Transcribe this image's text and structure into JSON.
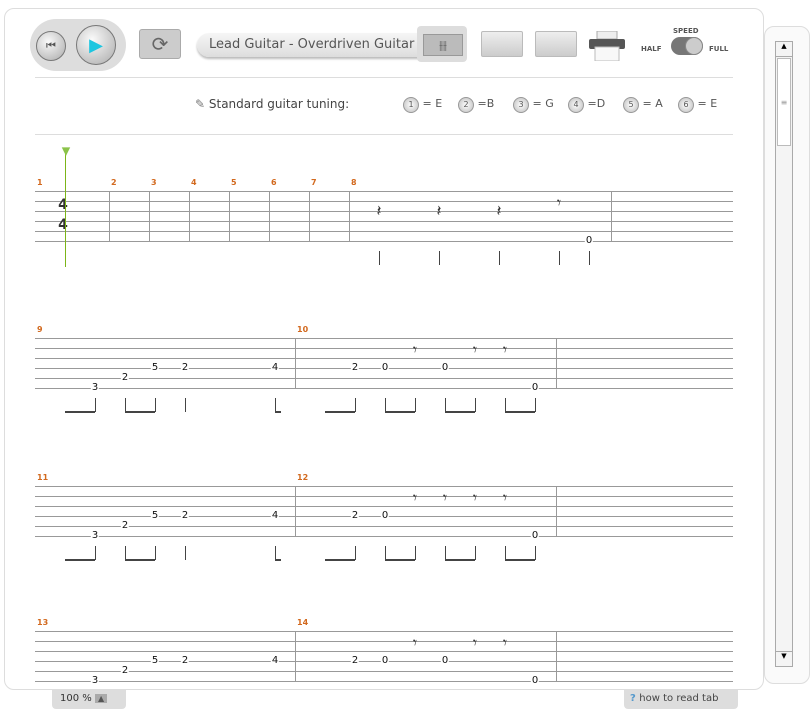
{
  "toolbar": {
    "track_name": "Lead Guitar - Overdriven Guitar",
    "speed_label": "SPEED",
    "speed_half": "HALF",
    "speed_full": "FULL",
    "speed_value": "full"
  },
  "tuning": {
    "label": "Standard guitar tuning:",
    "strings": [
      {
        "num": "1",
        "note": "= E"
      },
      {
        "num": "2",
        "note": "=B"
      },
      {
        "num": "3",
        "note": "= G"
      },
      {
        "num": "4",
        "note": "=D"
      },
      {
        "num": "5",
        "note": "= A"
      },
      {
        "num": "6",
        "note": "= E"
      }
    ]
  },
  "score": {
    "time_signature": [
      "4",
      "4"
    ],
    "playhead_measure": 1,
    "systems": [
      {
        "measures": [
          {
            "num": "1",
            "notes": []
          },
          {
            "num": "2",
            "notes": []
          },
          {
            "num": "3",
            "notes": []
          },
          {
            "num": "4",
            "notes": []
          },
          {
            "num": "5",
            "notes": []
          },
          {
            "num": "6",
            "notes": []
          },
          {
            "num": "7",
            "notes": []
          },
          {
            "num": "8",
            "notes": [
              {
                "rest": "quarter",
                "beat": 0
              },
              {
                "rest": "quarter",
                "beat": 2
              },
              {
                "rest": "quarter",
                "beat": 4
              },
              {
                "rest": "eighth",
                "beat": 6
              },
              {
                "string": 6,
                "fret": "0",
                "beat": 7
              }
            ]
          }
        ]
      },
      {
        "measures": [
          {
            "num": "9",
            "notes": [
              {
                "string": 6,
                "fret": "3",
                "beat": 2
              },
              {
                "string": 5,
                "fret": "2",
                "beat": 3
              },
              {
                "string": 4,
                "fret": "5",
                "beat": 4
              },
              {
                "string": 4,
                "fret": "2",
                "beat": 5
              },
              {
                "string": 4,
                "fret": "4",
                "beat": 8
              }
            ]
          },
          {
            "num": "10",
            "notes": [
              {
                "string": 4,
                "fret": "2",
                "beat": 2
              },
              {
                "string": 4,
                "fret": "0",
                "beat": 3
              },
              {
                "rest": "eighth",
                "beat": 4
              },
              {
                "string": 4,
                "fret": "0",
                "beat": 5
              },
              {
                "rest": "eighth",
                "beat": 6
              },
              {
                "rest": "eighth",
                "beat": 7
              },
              {
                "string": 6,
                "fret": "0",
                "beat": 8
              }
            ]
          }
        ]
      },
      {
        "measures": [
          {
            "num": "11",
            "notes": [
              {
                "string": 6,
                "fret": "3",
                "beat": 2
              },
              {
                "string": 5,
                "fret": "2",
                "beat": 3
              },
              {
                "string": 4,
                "fret": "5",
                "beat": 4
              },
              {
                "string": 4,
                "fret": "2",
                "beat": 5
              },
              {
                "string": 4,
                "fret": "4",
                "beat": 8
              }
            ]
          },
          {
            "num": "12",
            "notes": [
              {
                "string": 4,
                "fret": "2",
                "beat": 2
              },
              {
                "string": 4,
                "fret": "0",
                "beat": 3
              },
              {
                "rest": "eighth",
                "beat": 4
              },
              {
                "rest": "eighth",
                "beat": 5
              },
              {
                "rest": "eighth",
                "beat": 6
              },
              {
                "rest": "eighth",
                "beat": 7
              },
              {
                "string": 6,
                "fret": "0",
                "beat": 8
              }
            ]
          }
        ]
      },
      {
        "measures": [
          {
            "num": "13",
            "notes": [
              {
                "string": 6,
                "fret": "3",
                "beat": 2
              },
              {
                "string": 5,
                "fret": "2",
                "beat": 3
              },
              {
                "string": 4,
                "fret": "5",
                "beat": 4
              },
              {
                "string": 4,
                "fret": "2",
                "beat": 5
              },
              {
                "string": 4,
                "fret": "4",
                "beat": 8
              }
            ]
          },
          {
            "num": "14",
            "notes": [
              {
                "string": 4,
                "fret": "2",
                "beat": 2
              },
              {
                "string": 4,
                "fret": "0",
                "beat": 3
              },
              {
                "rest": "eighth",
                "beat": 4
              },
              {
                "string": 4,
                "fret": "0",
                "beat": 5
              },
              {
                "rest": "eighth",
                "beat": 6
              },
              {
                "rest": "eighth",
                "beat": 7
              },
              {
                "string": 6,
                "fret": "0",
                "beat": 8
              }
            ]
          }
        ]
      }
    ]
  },
  "footer": {
    "zoom": "100 %",
    "help": "how to read tab"
  }
}
